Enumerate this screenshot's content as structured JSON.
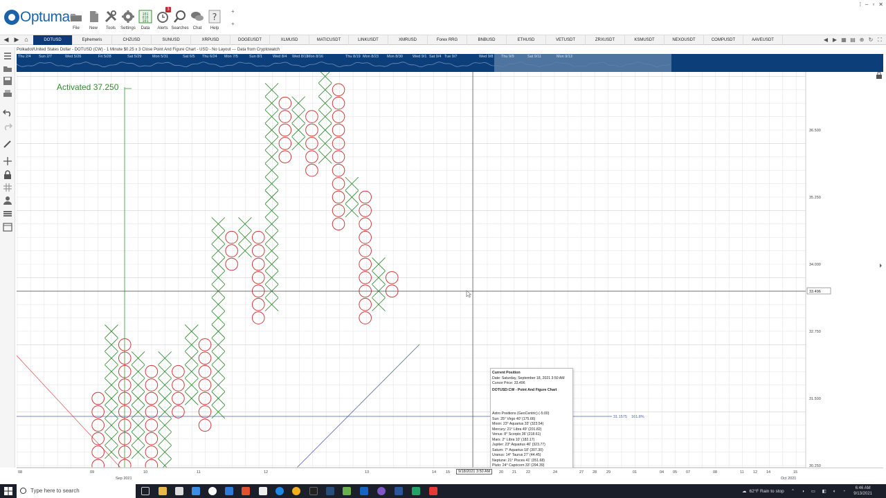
{
  "app": {
    "logo_text": "Optuma",
    "logo_mark": "®"
  },
  "ribbon": {
    "buttons": [
      {
        "label": "File",
        "icon": "folder-icon"
      },
      {
        "label": "New",
        "icon": "new-document-icon"
      },
      {
        "label": "Tools",
        "icon": "tools-icon"
      },
      {
        "label": "Settings",
        "icon": "gear-icon"
      },
      {
        "label": "Data",
        "icon": "binary-data-icon"
      },
      {
        "label": "Alerts",
        "icon": "alarm-clock-icon",
        "badge": "3"
      },
      {
        "label": "Searches",
        "icon": "search-icon"
      },
      {
        "label": "Chat",
        "icon": "chat-bubbles-icon"
      },
      {
        "label": "Help",
        "icon": "question-mark-icon"
      }
    ],
    "add_marks": [
      "+",
      "+"
    ]
  },
  "window_controls": [
    "⁞",
    "–",
    "▫",
    "✕"
  ],
  "tabs": [
    "DOTUSD",
    "Ephemeris",
    "CHZUSD",
    "SUNUSD",
    "XRPUSD",
    "DOGEUSDT",
    "XLMUSD",
    "MATICUSDT",
    "LINKUSDT",
    "XMRUSD",
    "Forex RRG",
    "BNBUSD",
    "ETHUSD",
    "VETUSDT",
    "ZRXUSDT",
    "KSMUSDT",
    "NEXOUSDT",
    "COMPUSDT",
    "AAVEUSDT"
  ],
  "active_tab": "DOTUSD",
  "chart_header": "Polkadot/United States Dollar - DOTUSD (CW) - 1 Minute $0.25 x 3 Close Point And Figure Chart - USD - No Layout --- Data from Cryptowatch",
  "overview_dates": [
    "Thu 2/4",
    "Sun 2/7",
    "Wed 5/26",
    "Fri 5/28",
    "Sat 5/29",
    "Mon 5/31",
    "Sat 6/5",
    "Thu 6/24",
    "Mon 7/5",
    "Sun 8/1",
    "Wed 8/4",
    "Wed 8/11",
    "Mon 8/16",
    "Thu 8/19",
    "Mon 8/23",
    "Mon 8/30",
    "Wed 9/1",
    "Sat 9/4",
    "Tue 9/7",
    "Wed 9/8",
    "Thu 9/9",
    "Sat 9/11",
    "Mon 9/13"
  ],
  "chart": {
    "activated_label": "Activated 37.250",
    "price_axis": [
      "36.500",
      "35.250",
      "34.000",
      "32.750",
      "31.500",
      "30.250"
    ],
    "cursor_price_tag": "33.496",
    "fib_label": "31.1575",
    "fib_pct": "161.8%",
    "x_ticks": [
      "08",
      "09",
      "10",
      "11",
      "12",
      "13",
      "14",
      "15",
      "20",
      "21",
      "22",
      "24",
      "27",
      "28",
      "29",
      "01",
      "04",
      "05",
      "07",
      "08",
      "11",
      "12",
      "14",
      "15"
    ],
    "x_month_labels": [
      "Sep 2021",
      "Oct 2021"
    ],
    "cursor_time_tag": "9/18/2021 3:50 AM",
    "colors": {
      "x": "#3a8f3a",
      "o": "#d23a3a",
      "grid": "#e6e6e6",
      "trend": "#4a63b8"
    }
  },
  "chart_data": {
    "type": "point-and-figure",
    "box_size": 0.25,
    "reversal": 3,
    "columns": [
      {
        "type": "O",
        "high": 31.5,
        "low": 30.25
      },
      {
        "type": "X",
        "low": 30.5,
        "high": 32.75
      },
      {
        "type": "O",
        "high": 32.5,
        "low": 30.25
      },
      {
        "type": "X",
        "low": 30.5,
        "high": 32.25
      },
      {
        "type": "O",
        "high": 32.0,
        "low": 30.25
      },
      {
        "type": "X",
        "low": 30.25,
        "high": 32.25
      },
      {
        "type": "O",
        "high": 32.0,
        "low": 31.25
      },
      {
        "type": "X",
        "low": 31.5,
        "high": 32.75
      },
      {
        "type": "O",
        "high": 32.5,
        "low": 31.0
      },
      {
        "type": "X",
        "low": 31.25,
        "high": 34.75
      },
      {
        "type": "O",
        "high": 34.5,
        "low": 34.0
      },
      {
        "type": "X",
        "low": 34.25,
        "high": 34.75
      },
      {
        "type": "O",
        "high": 34.5,
        "low": 33.0
      },
      {
        "type": "X",
        "low": 33.25,
        "high": 37.25
      },
      {
        "type": "O",
        "high": 37.0,
        "low": 36.0
      },
      {
        "type": "X",
        "low": 36.25,
        "high": 37.0
      },
      {
        "type": "O",
        "high": 36.75,
        "low": 35.75
      },
      {
        "type": "X",
        "low": 36.0,
        "high": 37.5
      },
      {
        "type": "O",
        "high": 37.25,
        "low": 34.75
      },
      {
        "type": "X",
        "low": 35.0,
        "high": 35.5
      },
      {
        "type": "O",
        "high": 35.25,
        "low": 33.0
      },
      {
        "type": "X",
        "low": 33.25,
        "high": 34.0
      },
      {
        "type": "O",
        "high": 33.75,
        "low": 33.5
      }
    ]
  },
  "tooltip": {
    "title": "Current Position",
    "date": "Date: Saturday, September 18, 2021 3:50 AM",
    "cursor_price": "Cursor Price: 33.496",
    "chart_name": "DOTUSD:CW - Point And Figure Chart",
    "astro_header": "Astro Positions (GeoCentric) (-5:00)",
    "astro": [
      "Sun: 25° Virgo 40' (175.66)",
      "Moon: 23° Aquarius 33' (323.54)",
      "Mercury: 21° Libra 49' (201.82)",
      "Venus: 8° Scorpio 36' (218.61)",
      "Mars: 2° Libra 10' (182.17)",
      "Jupiter: 23° Aquarius 46' (323.77)",
      "Saturn: 7° Aquarius 18' (307.30)",
      "Uranus: 14° Taurus 27' (44.45)",
      "Neptune: 21° Pisces 41' (351.68)",
      "Pluto: 24° Capricorn 33' (294.39)"
    ]
  },
  "taskbar": {
    "search_placeholder": "Type here to search",
    "weather": "62°F  Rain to stop",
    "time": "6:46 AM",
    "date": "9/13/2021"
  }
}
